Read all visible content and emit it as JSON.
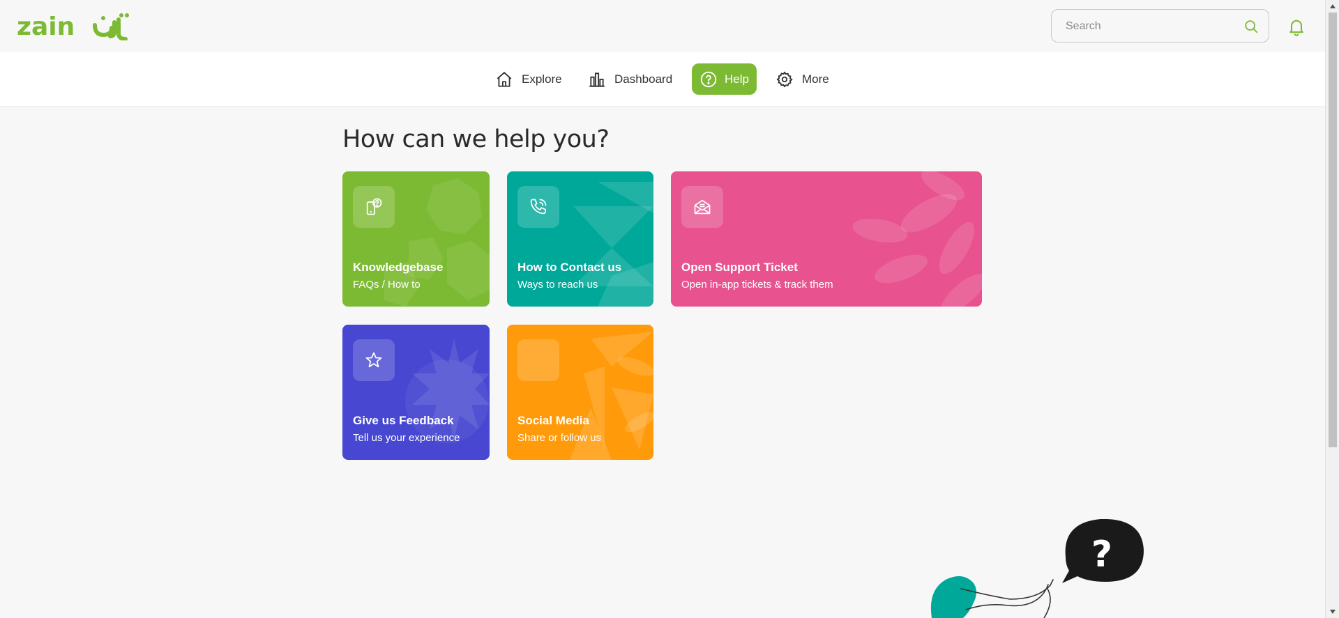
{
  "header": {
    "logo_text": "zain",
    "logo_arabic": "زين",
    "search_placeholder": "Search"
  },
  "nav": {
    "items": [
      {
        "label": "Explore",
        "icon": "home-icon",
        "active": false
      },
      {
        "label": "Dashboard",
        "icon": "bar-chart-icon",
        "active": false
      },
      {
        "label": "Help",
        "icon": "question-circle-icon",
        "active": true
      },
      {
        "label": "More",
        "icon": "gear-icon",
        "active": false
      }
    ]
  },
  "main": {
    "heading": "How can we help you?",
    "cards": [
      {
        "title": "Knowledgebase",
        "subtitle": "FAQs / How to",
        "icon": "phone-question-icon",
        "color": "#7dba34"
      },
      {
        "title": "How to Contact us",
        "subtitle": "Ways to reach us",
        "icon": "phone-call-icon",
        "color": "#00a899"
      },
      {
        "title": "Open Support Ticket",
        "subtitle": "Open in-app tickets & track them",
        "icon": "envelope-open-icon",
        "color": "#e8528f"
      },
      {
        "title": "Give us Feedback",
        "subtitle": "Tell us your experience",
        "icon": "star-icon",
        "color": "#4747d1"
      },
      {
        "title": "Social Media",
        "subtitle": "Share or follow us",
        "icon": "empty-icon",
        "color": "#ff9a0a"
      }
    ]
  },
  "colors": {
    "brand": "#7dba34",
    "background": "#f7f7f7"
  }
}
